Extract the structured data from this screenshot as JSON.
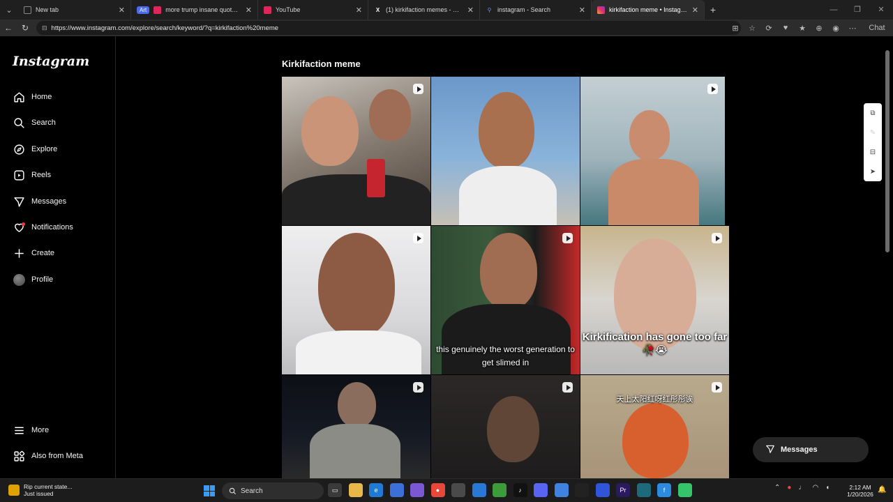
{
  "browser": {
    "tabs": [
      {
        "label": "New tab",
        "icon": "newtab-icon",
        "color": "#555555"
      },
      {
        "label": "more trump insane quotes out of",
        "icon": "youtube-icon",
        "color": "#e0245e",
        "group": "Art"
      },
      {
        "label": "YouTube",
        "icon": "youtube-icon",
        "color": "#e0245e"
      },
      {
        "label": "(1) kirkifaction memes - Search / X",
        "icon": "x-icon",
        "color": "#ffffff"
      },
      {
        "label": "instagram - Search",
        "icon": "search-icon",
        "color": "#4b6cf2"
      },
      {
        "label": "kirkifaction meme • Instagram",
        "icon": "instagram-icon",
        "color": "#e1306c"
      }
    ],
    "url": "https://www.instagram.com/explore/search/keyword/?q=kirkifaction%20meme",
    "chat_label": "Chat"
  },
  "sidebar": {
    "logo": "Instagram",
    "items": [
      {
        "label": "Home",
        "icon": "home-icon"
      },
      {
        "label": "Search",
        "icon": "search-icon"
      },
      {
        "label": "Explore",
        "icon": "compass-icon"
      },
      {
        "label": "Reels",
        "icon": "reels-icon"
      },
      {
        "label": "Messages",
        "icon": "messages-icon"
      },
      {
        "label": "Notifications",
        "icon": "heart-icon"
      },
      {
        "label": "Create",
        "icon": "plus-icon"
      },
      {
        "label": "Profile",
        "icon": "avatar"
      }
    ],
    "more": "More",
    "also_from_meta": "Also from Meta"
  },
  "main": {
    "title": "Kirkifaction meme",
    "posts": [
      {
        "caption": "",
        "bg": "#8a7f74",
        "face": "#c99478"
      },
      {
        "caption": "",
        "bg": "#6b98c9",
        "face": "#a8704e"
      },
      {
        "caption": "",
        "bg": "#c4cfd4",
        "face": "#c98c6f"
      },
      {
        "caption": "",
        "bg": "#d9d9dc",
        "face": "#8d5b44"
      },
      {
        "caption": "this genuinely the worst generation to get slimed in",
        "bg": "#2e4a32",
        "face": "#a06c52"
      },
      {
        "caption": "Kirkification has gone too far 🥀😭",
        "bg": "#d8d5d0",
        "face": "#d7ad98"
      },
      {
        "caption": "",
        "bg": "#0d0f16",
        "face": "#8a6d5c"
      },
      {
        "caption": "",
        "bg": "#1e1c1c",
        "face": "#5f4636"
      },
      {
        "caption": "天上太阳红呀红彤彤诶",
        "bg": "#b8a98d",
        "face": "#d8602f"
      }
    ],
    "messages_pill": "Messages"
  },
  "taskbar": {
    "news_title": "Rip current state...",
    "news_sub": "Just issued",
    "search_placeholder": "Search",
    "time": "2:12 AM",
    "date": "1/20/2026"
  }
}
